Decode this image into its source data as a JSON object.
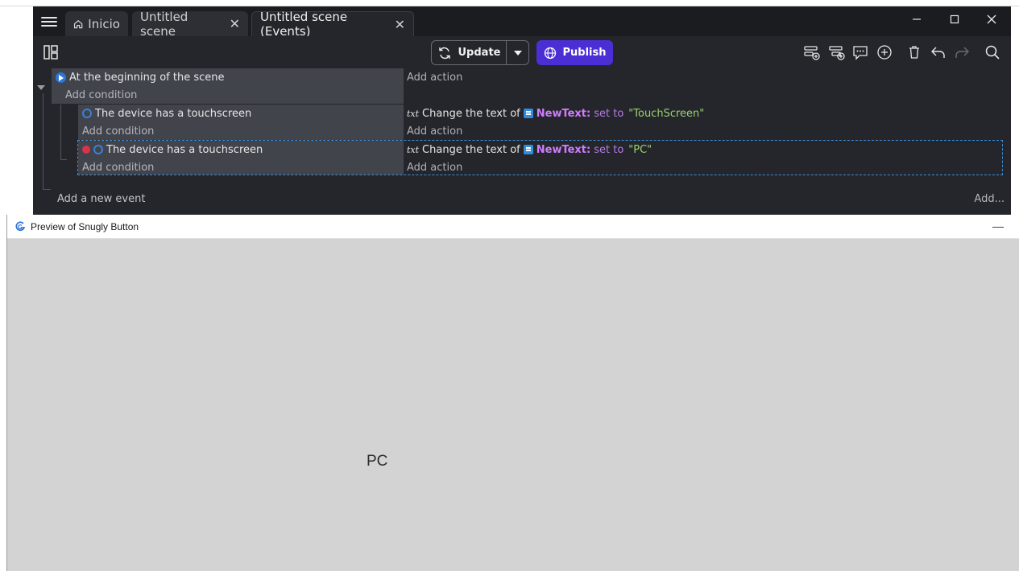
{
  "tabs": {
    "home_label": "Inicio",
    "scene_label": "Untitled scene",
    "events_label": "Untitled scene (Events)"
  },
  "toolbar": {
    "update_label": "Update",
    "publish_label": "Publish",
    "publish_color": "#4c2fd4"
  },
  "events": {
    "event1": {
      "condition": "At the beginning of the scene",
      "add_condition": "Add condition",
      "add_action": "Add action"
    },
    "event2": {
      "condition": "The device has a touchscreen",
      "add_condition": "Add condition",
      "action_prefix": "Change the text of",
      "action_object": "NewText:",
      "action_op": "set to",
      "action_value": "\"TouchScreen\"",
      "add_action": "Add action"
    },
    "event3": {
      "condition": "The device has a touchscreen",
      "add_condition": "Add condition",
      "action_prefix": "Change the text of",
      "action_object": "NewText:",
      "action_op": "set to",
      "action_value": "\"PC\"",
      "add_action": "Add action"
    },
    "add_new_event": "Add a new event",
    "add_more": "Add..."
  },
  "preview": {
    "title": "Preview of Snugly Button",
    "canvas_text": "PC"
  }
}
